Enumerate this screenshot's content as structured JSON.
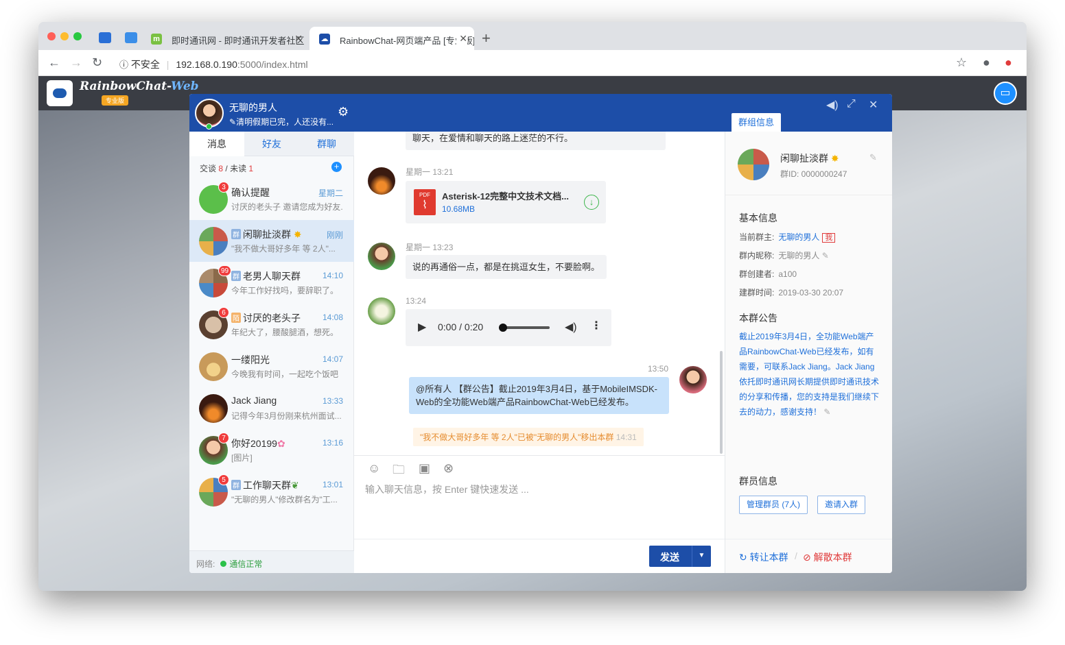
{
  "browser": {
    "tabs": [
      {
        "title": "即时通讯网 - 即时通讯开发者社区"
      },
      {
        "title": "RainbowChat-网页端产品 [专业版]"
      }
    ],
    "insecure_label": "不安全",
    "url_host": "192.168.0.190",
    "url_path": ":5000/index.html",
    "icons": [
      "back-icon",
      "forward-icon",
      "reload-icon",
      "info-icon",
      "star-icon",
      "account-icon",
      "extension-icon"
    ]
  },
  "app": {
    "brand_main": "RainbowChat-",
    "brand_web": "Web",
    "brand_badge": "专业版"
  },
  "profile": {
    "name": "无聊的男人",
    "signature": "清明假期已完，人还没有..."
  },
  "left_tabs": [
    "消息",
    "好友",
    "群聊"
  ],
  "stats": {
    "talk_label": "交谈",
    "talk_count": "8",
    "unread_label": "未读",
    "unread_count": "1"
  },
  "conversations": [
    {
      "title": "确认提醒",
      "time": "星期二",
      "preview": "讨厌的老头子 邀请您成为好友.",
      "badge": "3",
      "tag": ""
    },
    {
      "title": "闲聊扯淡群",
      "time": "刚刚",
      "preview": "\"我不做大哥好多年 等 2人\"...",
      "badge": "",
      "tag": "群"
    },
    {
      "title": "老男人聊天群",
      "time": "14:10",
      "preview": "今年工作好找吗，要辞职了。",
      "badge": "99",
      "tag": "群"
    },
    {
      "title": "讨厌的老头子",
      "time": "14:08",
      "preview": "年纪大了，腰酸腿酒，想死。",
      "badge": "6",
      "tag": "陌"
    },
    {
      "title": "一缕阳光",
      "time": "14:07",
      "preview": "今晚我有时间，一起吃个饭吧",
      "badge": "",
      "tag": ""
    },
    {
      "title": "Jack Jiang",
      "time": "13:33",
      "preview": "记得今年3月份刚来杭州面试...",
      "badge": "",
      "tag": ""
    },
    {
      "title": "你好20199",
      "time": "13:16",
      "preview": "[图片]",
      "badge": "7",
      "tag": ""
    },
    {
      "title": "工作聊天群",
      "time": "13:01",
      "preview": "\"无聊的男人\"修改群名为\"工...",
      "badge": "5",
      "tag": "群"
    }
  ],
  "network": {
    "label": "网络:",
    "status": "通信正常"
  },
  "chat": {
    "top_partial": "聊天，在爱情和聊天的路上迷茫的不行。",
    "m1_time": "星期一 13:21",
    "file_name": "Asterisk-12完整中文技术文档...",
    "file_size": "10.68MB",
    "m2_time": "星期一 13:23",
    "m2_text": "说的再通俗一点，都是在挑逗女生，不要脸啊。",
    "m3_time": "13:24",
    "audio_time": "0:00 / 0:20",
    "m4_time": "13:50",
    "m4_text": "@所有人 【群公告】截止2019年3月4日，基于MobileIMSDK-Web的全功能Web端产品RainbowChat-Web已经发布。",
    "notice": "\"我不做大哥好多年 等 2人\"已被\"无聊的男人\"移出本群",
    "notice_time": "14:31",
    "input_placeholder": "输入聊天信息，按 Enter 键快速发送 ...",
    "send_label": "发送"
  },
  "group": {
    "tab": "群组信息",
    "name": "闲聊扯淡群",
    "id": "群ID: 0000000247",
    "basic_title": "基本信息",
    "owner_label": "当前群主:",
    "owner": "无聊的男人",
    "me_tag": "我",
    "nick_label": "群内昵称:",
    "nick": "无聊的男人",
    "creator_label": "群创建者:",
    "creator": "a100",
    "created_label": "建群时间:",
    "created": "2019-03-30 20:07",
    "ann_title": "本群公告",
    "ann": "截止2019年3月4日，全功能Web端产品RainbowChat-Web已经发布，如有需要，可联系Jack Jiang。Jack Jiang依托即时通讯网长期提供即时通讯技术的分享和传播，您的支持是我们继续下去的动力，感谢支持！",
    "members_title": "群员信息",
    "manage_btn": "管理群员 (7人)",
    "invite_btn": "邀请入群",
    "transfer": "转让本群",
    "sep": "/",
    "dissolve": "解散本群"
  }
}
